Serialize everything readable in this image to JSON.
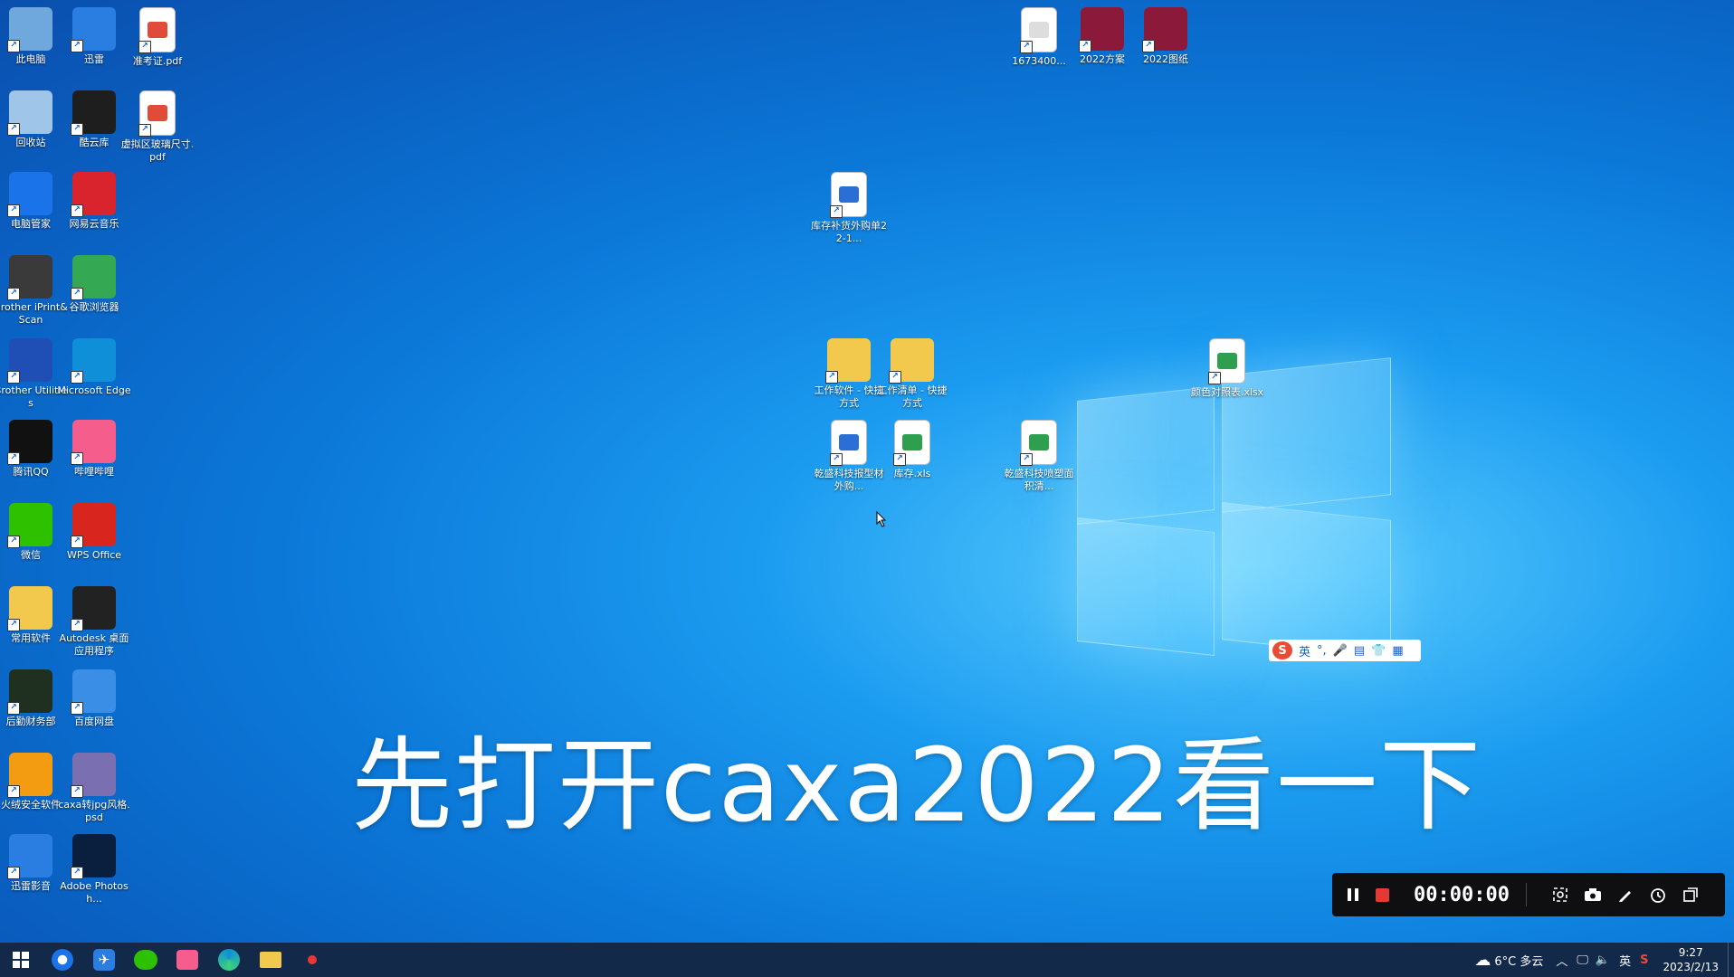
{
  "desktop": {
    "left_icons": [
      {
        "label": "此电脑",
        "icon": "computer-icon",
        "color": "#6fa8dc"
      },
      {
        "label": "迅雷",
        "icon": "xunlei-bird-icon",
        "color": "#2a7de1"
      },
      {
        "label": "准考证.pdf",
        "icon": "pdf-icon",
        "color": "#e04b3a"
      },
      {
        "label": "回收站",
        "icon": "recycle-bin-icon",
        "color": "#9fc5e8"
      },
      {
        "label": "酷云库",
        "icon": "kuyun-icon",
        "color": "#1e1e1e"
      },
      {
        "label": "虚拟区玻璃尺寸.pdf",
        "icon": "pdf-icon",
        "color": "#e04b3a"
      },
      {
        "label": "电脑管家",
        "icon": "pc-manager-icon",
        "color": "#1a73e8"
      },
      {
        "label": "网易云音乐",
        "icon": "netease-music-icon",
        "color": "#d9232d"
      },
      {
        "label": "Brother iPrint&Scan",
        "icon": "printer-icon",
        "color": "#3a3a3a"
      },
      {
        "label": "谷歌浏览器",
        "icon": "chrome-icon",
        "color": "#34a853"
      },
      {
        "label": "Brother Utilities",
        "icon": "brother-utilities-icon",
        "color": "#1f4fb5"
      },
      {
        "label": "Microsoft Edge",
        "icon": "edge-icon",
        "color": "#0f8fd8"
      },
      {
        "label": "腾讯QQ",
        "icon": "qq-penguin-icon",
        "color": "#111111"
      },
      {
        "label": "哔哩哔哩",
        "icon": "bilibili-icon",
        "color": "#f45d8c"
      },
      {
        "label": "微信",
        "icon": "wechat-icon",
        "color": "#2dc100"
      },
      {
        "label": "WPS Office",
        "icon": "wps-icon",
        "color": "#d8261f"
      },
      {
        "label": "常用软件",
        "icon": "folder-icon",
        "color": "#f2c94c"
      },
      {
        "label": "Autodesk 桌面应用程序",
        "icon": "autodesk-icon",
        "color": "#222222"
      },
      {
        "label": "后勤财务部",
        "icon": "folder-dark-icon",
        "color": "#203020"
      },
      {
        "label": "百度网盘",
        "icon": "baidu-netdisk-icon",
        "color": "#3a8ee6"
      },
      {
        "label": "火绒安全软件",
        "icon": "huorong-icon",
        "color": "#f39c12"
      },
      {
        "label": "caxa转jpg风格.psd",
        "icon": "psd-file-icon",
        "color": "#7a6fb0"
      },
      {
        "label": "迅雷影音",
        "icon": "xunlei-player-icon",
        "color": "#2a7de1"
      },
      {
        "label": "Adobe Photosh...",
        "icon": "photoshop-icon",
        "color": "#0a1f3d"
      }
    ],
    "top_right_icons": [
      {
        "label": "1673400...",
        "icon": "image-file-icon",
        "color": "#dddddd"
      },
      {
        "label": "2022方案",
        "icon": "winrar-icon",
        "color": "#8b1a3a"
      },
      {
        "label": "2022图纸",
        "icon": "winrar-icon",
        "color": "#8b1a3a"
      }
    ],
    "center_icons": [
      {
        "label": "库存补货外购单22-1...",
        "icon": "word-doc-icon",
        "color": "#2b6fd6"
      },
      {
        "label": "工作软件 - 快捷方式",
        "icon": "folder-icon",
        "color": "#f2c94c"
      },
      {
        "label": "工作清单 - 快捷方式",
        "icon": "folder-icon",
        "color": "#f2c94c"
      },
      {
        "label": "颜色对照表.xlsx",
        "icon": "excel-icon",
        "color": "#2e9e4f"
      },
      {
        "label": "乾盛科技报型材外购...",
        "icon": "word-doc-icon",
        "color": "#2b6fd6"
      },
      {
        "label": "库存.xls",
        "icon": "excel-icon",
        "color": "#2e9e4f"
      },
      {
        "label": "乾盛科技喷塑面积清...",
        "icon": "excel-icon",
        "color": "#2e9e4f"
      }
    ]
  },
  "subtitle": "先打开caxa2022看一下",
  "ime_toolbar": {
    "logo": "S",
    "lang": "英",
    "punct": "°,"
  },
  "recorder": {
    "timer": "00:00:00"
  },
  "taskbar": {
    "weather": "6°C 多云",
    "input_lang": "英",
    "time": "9:27",
    "date": "2023/2/13"
  },
  "colors": {
    "taskbar": "#13294a",
    "desktop_blue": "#0b78d8",
    "recorder_red": "#e53935"
  }
}
